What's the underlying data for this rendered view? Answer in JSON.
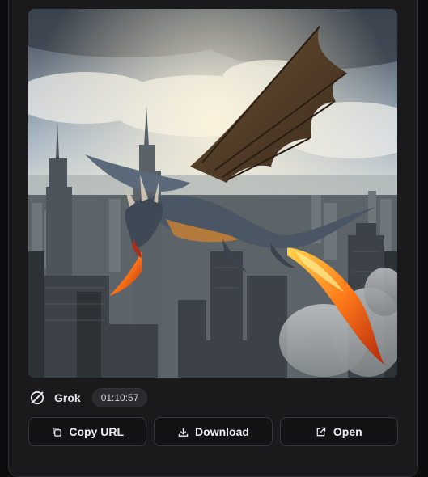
{
  "image": {
    "subject": "dragon-over-city-image"
  },
  "meta": {
    "model_name": "Grok",
    "model_icon": "grok-logo-icon",
    "duration": "01:10:57"
  },
  "actions": {
    "copy_url": {
      "label": "Copy URL",
      "icon": "copy-icon"
    },
    "download": {
      "label": "Download",
      "icon": "download-icon"
    },
    "open": {
      "label": "Open",
      "icon": "external-link-icon"
    }
  },
  "colors": {
    "panel_bg": "#1a1a1d",
    "button_bg": "#131316",
    "button_border": "#36363c",
    "badge_bg": "#2a2a2f",
    "text": "#ececf0"
  }
}
